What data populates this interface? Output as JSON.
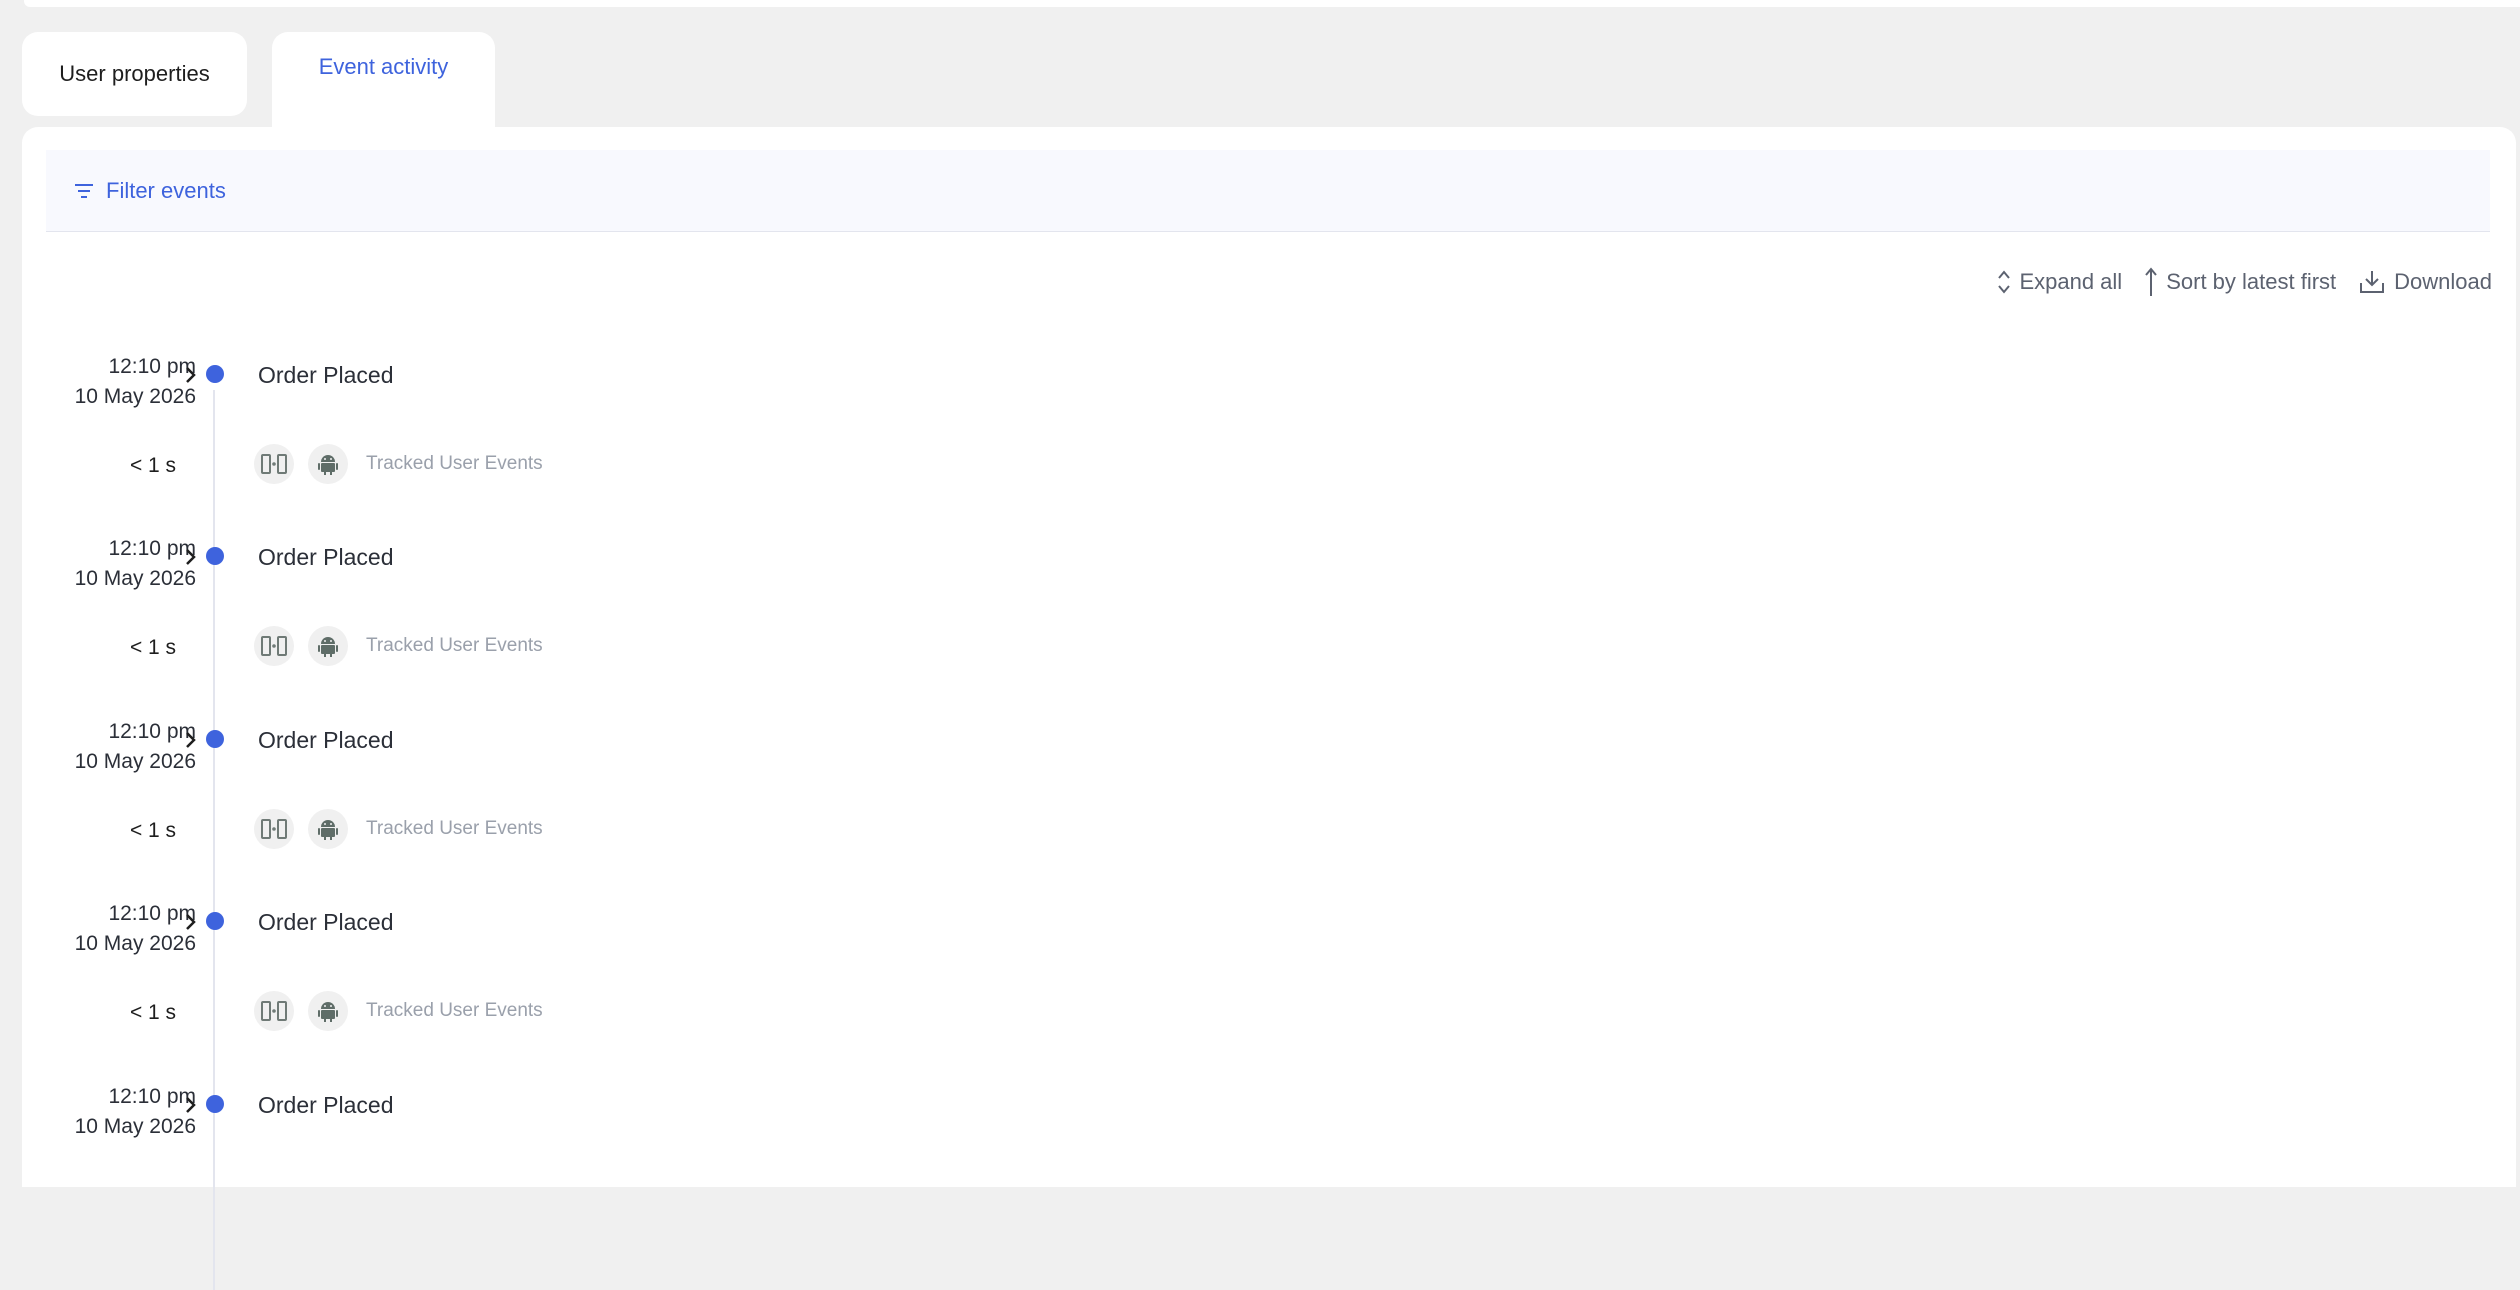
{
  "tabs": [
    {
      "label": "User properties",
      "active": false
    },
    {
      "label": "Event activity",
      "active": true
    }
  ],
  "filter": {
    "label": "Filter events",
    "icon": "filter-icon"
  },
  "actions": {
    "expand_all": "Expand all",
    "sort": "Sort by latest first",
    "download": "Download"
  },
  "events": [
    {
      "time": "12:10 pm",
      "date": "10 May 2026",
      "name": "Order Placed",
      "duration": "< 1 s",
      "source": "Tracked User Events",
      "icons": [
        "cube-sdk-icon",
        "android-icon"
      ]
    },
    {
      "time": "12:10 pm",
      "date": "10 May 2026",
      "name": "Order Placed",
      "duration": "< 1 s",
      "source": "Tracked User Events",
      "icons": [
        "cube-sdk-icon",
        "android-icon"
      ]
    },
    {
      "time": "12:10 pm",
      "date": "10 May 2026",
      "name": "Order Placed",
      "duration": "< 1 s",
      "source": "Tracked User Events",
      "icons": [
        "cube-sdk-icon",
        "android-icon"
      ]
    },
    {
      "time": "12:10 pm",
      "date": "10 May 2026",
      "name": "Order Placed",
      "duration": "< 1 s",
      "source": "Tracked User Events",
      "icons": [
        "cube-sdk-icon",
        "android-icon"
      ]
    },
    {
      "time": "12:10 pm",
      "date": "10 May 2026",
      "name": "Order Placed"
    }
  ],
  "colors": {
    "accent": "#3e63dd",
    "text": "#2b2f38",
    "muted": "#9aa0ab"
  }
}
